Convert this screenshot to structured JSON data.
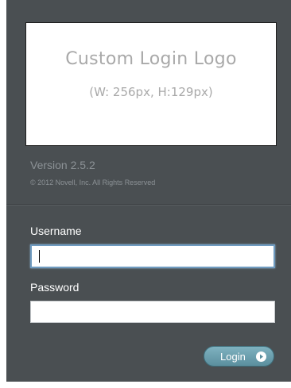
{
  "logo": {
    "title": "Custom Login Logo",
    "dimensions": "(W: 256px, H:129px)"
  },
  "version": "Version 2.5.2",
  "copyright": "© 2012 Novell, Inc. All Rights Reserved",
  "form": {
    "username_label": "Username",
    "username_value": "",
    "password_label": "Password",
    "password_value": "",
    "login_label": "Login",
    "login_icon": "arrow-right-circle-icon"
  },
  "colors": {
    "panel_bg": "#4a4f52",
    "button_bg": "#6ea2b1",
    "focus_border": "#6f9bc0"
  }
}
